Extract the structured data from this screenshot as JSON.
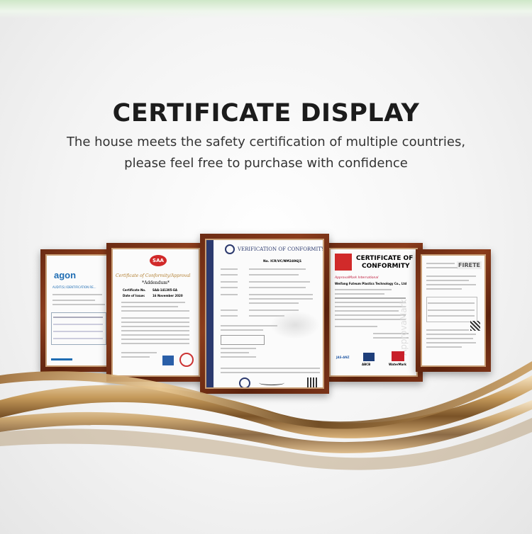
{
  "header": {
    "title": "CERTIFICATE DISPLAY",
    "subtitle_line1": "The house meets the safety certification of multiple countries,",
    "subtitle_line2": "please feel free to purchase with confidence"
  },
  "certificates": {
    "agon": {
      "brand": "agon",
      "heading": "AUDIT(S) IDENTIFICATION RE..."
    },
    "saa": {
      "badge": "SAA",
      "heading": "Certificate of Conformity/Approval",
      "addendum": "*Addendum*",
      "cert_no_label": "Certificate No.",
      "cert_no": "SAA-141305-EA",
      "date_label": "Date of Issue:",
      "date": "16 November 2020"
    },
    "verification": {
      "heading": "VERIFICATION OF CONFORMITY",
      "number": "No. ICR/VC/NM2496J1"
    },
    "watermark": {
      "heading_line1": "CERTIFICATE OF",
      "heading_line2": "CONFORMITY",
      "issuer": "ApprovalMark International",
      "company": "Weifang Futeum Plastics Technology Co., Ltd",
      "watermark_text": "ApprovaMark",
      "logo1": "JAS-ANZ",
      "logo2": "ABCB",
      "logo3": "WaterMark"
    },
    "firete": {
      "brand": "FIRETE"
    }
  },
  "colors": {
    "frame": "#6b2b13",
    "gold": "#c59a5b",
    "title": "#1c1c1c"
  }
}
